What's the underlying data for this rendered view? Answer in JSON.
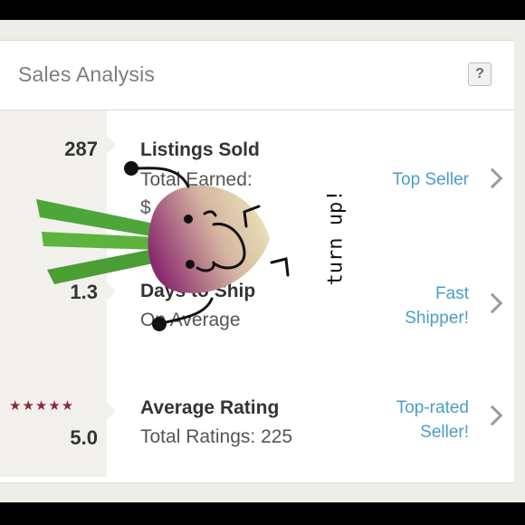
{
  "card": {
    "title": "Sales Analysis",
    "help_label": "?"
  },
  "rows": [
    {
      "stat": "287",
      "title": "Listings Sold",
      "subtitle": "Total Earned:",
      "subtitle2": "$",
      "badge": "Top Seller"
    },
    {
      "stat": "1.3",
      "title": "Days to Ship",
      "subtitle": "On Average",
      "badge_line1": "Fast",
      "badge_line2": "Shipper!"
    },
    {
      "stat": "5.0",
      "stars": "★★★★★",
      "title": "Average Rating",
      "subtitle": "Total Ratings: 225",
      "badge_line1": "Top-rated",
      "badge_line2": "Seller!"
    }
  ],
  "sticker": {
    "caption": "turn up!",
    "colors": {
      "bulb_top": "#e8e6b8",
      "bulb_bottom": "#8a2a6e",
      "greens": "#4da63a"
    }
  },
  "colors": {
    "accent": "#4a9ec6",
    "star": "#8a2a3a"
  }
}
